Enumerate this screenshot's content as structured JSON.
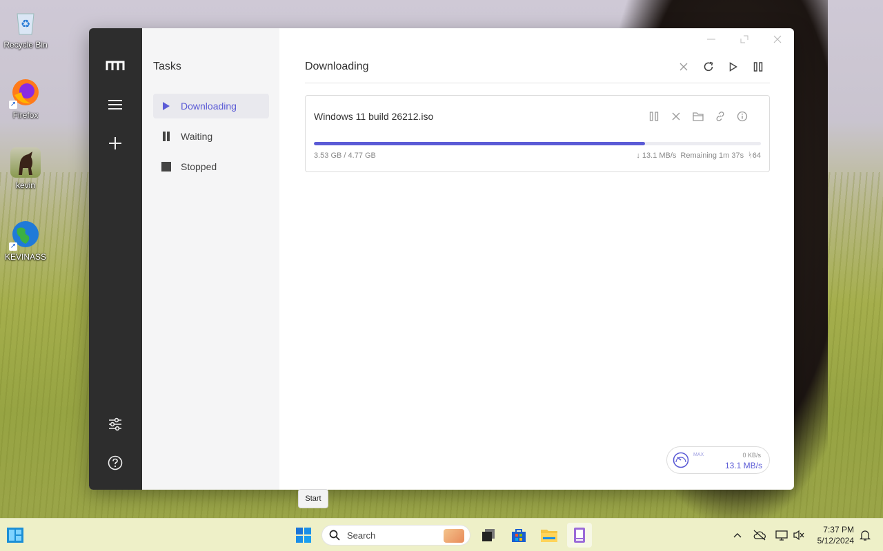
{
  "desktop": {
    "icons": [
      {
        "label": "Recycle Bin"
      },
      {
        "label": "Firefox"
      },
      {
        "label": "kevin"
      },
      {
        "label": "KEVINASS"
      }
    ]
  },
  "app": {
    "sidebar": {
      "title": "Tasks",
      "items": [
        {
          "label": "Downloading",
          "icon": "play-icon",
          "active": true
        },
        {
          "label": "Waiting",
          "icon": "pause-icon"
        },
        {
          "label": "Stopped",
          "icon": "stop-icon"
        }
      ]
    },
    "main": {
      "title": "Downloading"
    },
    "task": {
      "name": "Windows 11 build 26212.iso",
      "size": "3.53 GB / 4.77 GB",
      "progress": 0.74,
      "speed": "↓ 13.1 MB/s",
      "remaining": "Remaining 1m 37s",
      "connections": "64"
    },
    "speedometer": {
      "max_label": "MAX",
      "upload": "0 KB/s",
      "download": "13.1 MB/s"
    },
    "accent": "#5b5bd6"
  },
  "tooltip": {
    "text": "Start"
  },
  "taskbar": {
    "search_placeholder": "Search",
    "time": "7:37 PM",
    "date": "5/12/2024"
  }
}
